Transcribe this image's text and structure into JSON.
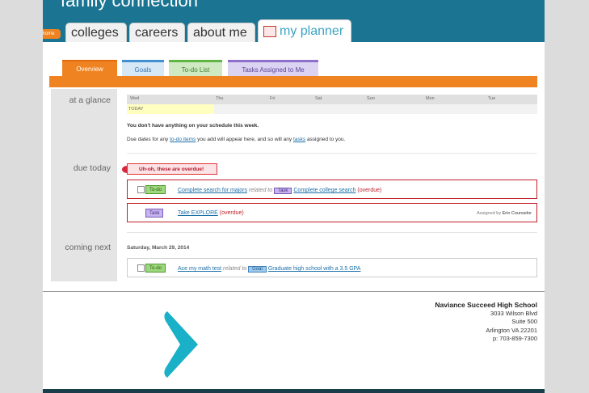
{
  "header": {
    "brand": "family connection",
    "home": "home",
    "tabs": [
      "colleges",
      "careers",
      "about me",
      "my planner"
    ]
  },
  "subtabs": [
    "Overview",
    "Goals",
    "To-do List",
    "Tasks Assigned to Me"
  ],
  "sections": {
    "glance": "at a glance",
    "due": "due today",
    "next": "coming next"
  },
  "week": {
    "days": [
      "Wed",
      "Thu",
      "Fri",
      "Sat",
      "Sun",
      "Mon",
      "Tue"
    ],
    "today": "TODAY"
  },
  "glance": {
    "empty": "You don't have anything on your schedule this week.",
    "hint_pre": "Due dates for any ",
    "hint_link1": "to-do items",
    "hint_mid": " you add will appear here, and so will any ",
    "hint_link2": "tasks",
    "hint_post": " assigned to you."
  },
  "due": {
    "badge": "Uh-oh, these are overdue!",
    "item1": {
      "tag": "To-do",
      "title": "Complete search for majors",
      "related": "related to",
      "rtag": "Task",
      "rtitle": "Complete college search",
      "status": "(overdue)"
    },
    "item2": {
      "tag": "Task",
      "title": "Take EXPLORE",
      "status": "(overdue)",
      "assigned_pre": "Assigned by",
      "assigned_by": "Erin Counselor"
    }
  },
  "next": {
    "date": "Saturday, March 29, 2014",
    "item": {
      "tag": "To-do",
      "title": "Ace my math test",
      "related": "related to",
      "rtag": "Goal",
      "rtitle": "Graduate high school with a 3.5 GPA"
    }
  },
  "footer": {
    "school": "Naviance Succeed High School",
    "address1": "3033 Wilson Blvd",
    "address2": "Suite 500",
    "address3": "Arlington VA 22201",
    "phone": "p: 703-859-7300"
  },
  "colors": {
    "header": "#1b7592",
    "accent": "#f08321",
    "overdue": "#c0202a",
    "logo": "#1ab0c8"
  }
}
